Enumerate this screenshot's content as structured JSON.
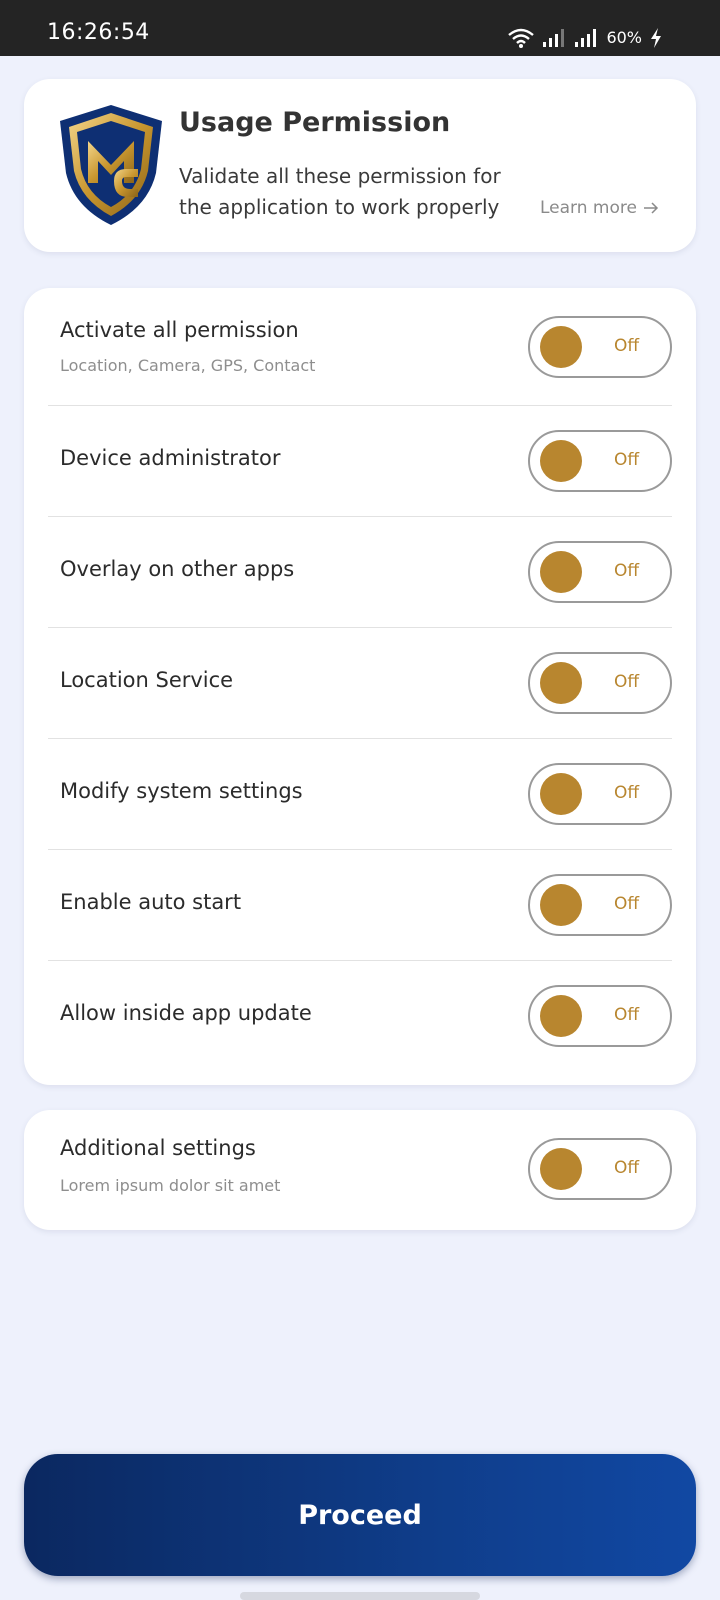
{
  "status_bar": {
    "time": "16:26:54",
    "battery": "60%",
    "icons": [
      "wifi-icon",
      "signal-icon",
      "signal-icon",
      "charging-bolt-icon"
    ]
  },
  "header": {
    "title": "Usage Permission",
    "description": "Validate all these permission for the application to work properly",
    "learn_more": "Learn more",
    "learn_more_icon": "arrow-right-icon",
    "logo_icon": "shield-logo-icon"
  },
  "permissions": [
    {
      "title": "Activate all permission",
      "subtitle": "Location, Camera, GPS, Contact",
      "state": "Off"
    },
    {
      "title": "Device administrator",
      "subtitle": "",
      "state": "Off"
    },
    {
      "title": "Overlay on other apps",
      "subtitle": "",
      "state": "Off"
    },
    {
      "title": "Location Service",
      "subtitle": "",
      "state": "Off"
    },
    {
      "title": "Modify system settings",
      "subtitle": "",
      "state": "Off"
    },
    {
      "title": "Enable auto start",
      "subtitle": "",
      "state": "Off"
    },
    {
      "title": "Allow inside app update",
      "subtitle": "",
      "state": "Off"
    }
  ],
  "additional": {
    "title": "Additional settings",
    "subtitle": "Lorem ipsum dolor sit amet",
    "state": "Off"
  },
  "proceed_label": "Proceed",
  "colors": {
    "accent_gold": "#b8862f",
    "button_navy": "#0f3d8a",
    "background": "#eef1fc"
  }
}
